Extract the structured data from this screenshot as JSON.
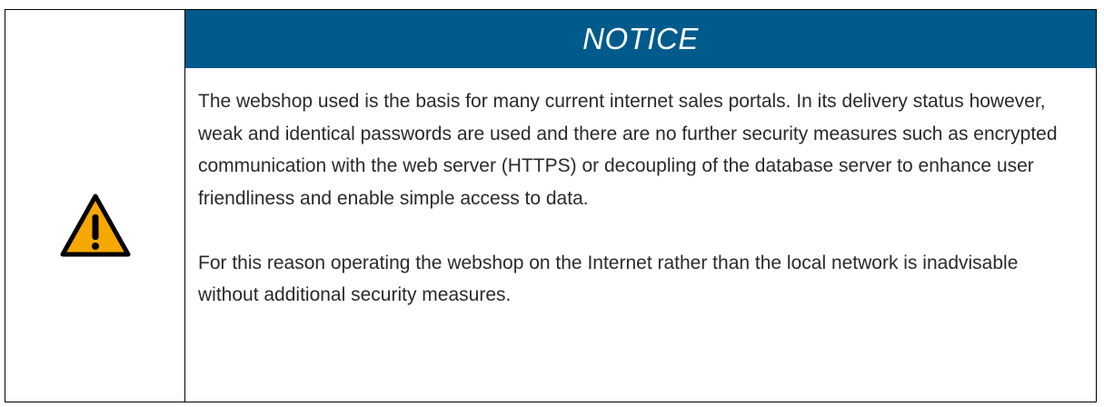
{
  "notice": {
    "title": "NOTICE",
    "icon": "warning-triangle-icon",
    "colors": {
      "header_bg": "#005a8c",
      "header_text": "#ffffff",
      "icon_fill": "#f6a800",
      "icon_stroke": "#000000"
    },
    "paragraphs": [
      "The webshop used is the basis for many current internet sales portals. In its delivery status however, weak and identical passwords are used and there are no further security measures such as encrypted communication with the web server (HTTPS) or decoupling of the database server to enhance user friendliness and enable simple access to data.",
      "For this reason operating the webshop on the Internet rather than the local network is inadvisable without additional security measures."
    ]
  }
}
